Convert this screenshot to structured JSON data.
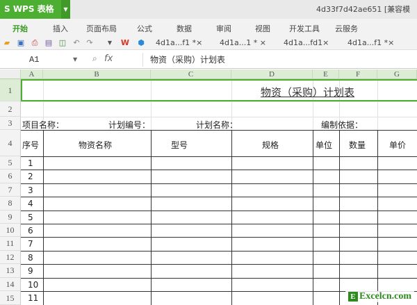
{
  "app": {
    "logo": "S WPS 表格",
    "doc_title": "4d33f7d42ae651 [兼容模"
  },
  "menu": [
    "开始",
    "插入",
    "页面布局",
    "公式",
    "数据",
    "审阅",
    "视图",
    "开发工具",
    "云服务"
  ],
  "tabs": [
    "4d1a...f1 *×",
    "4d1a...1 * ×",
    "4d1a...fd1×",
    "4d1a...f1 *×"
  ],
  "formula": {
    "cell": "A1",
    "fx": "fx",
    "value": "物资（采购）计划表"
  },
  "columns": [
    "A",
    "B",
    "C",
    "D",
    "E",
    "F",
    "G"
  ],
  "rows": [
    "1",
    "2",
    "3",
    "4",
    "5",
    "6",
    "7",
    "8",
    "9",
    "10",
    "11",
    "12",
    "13",
    "14",
    "15"
  ],
  "sheet": {
    "title": "物资（采购）计划表",
    "row3": [
      "项目名称：",
      "计划编号：",
      "计划名称：",
      "编制依据："
    ],
    "headers": [
      "序号",
      "物资名称",
      "型号",
      "规格",
      "单位",
      "数量",
      "单价"
    ],
    "serials": [
      "1",
      "2",
      "3",
      "4",
      "5",
      "6",
      "7",
      "8",
      "9",
      "10",
      "11"
    ]
  },
  "watermark": "Excelcn.com"
}
